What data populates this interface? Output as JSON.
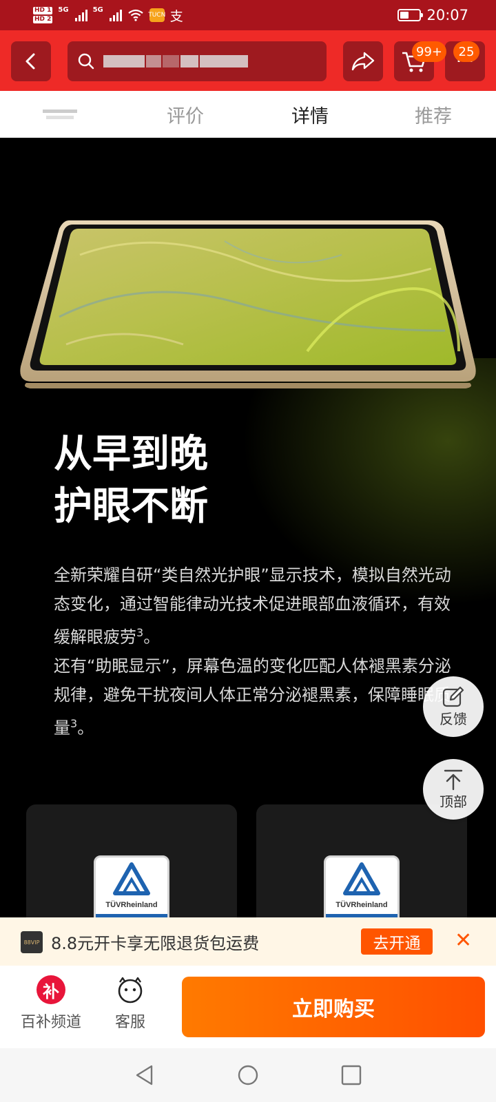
{
  "status_bar": {
    "time": "20:07",
    "hd_labels": [
      "HD 1",
      "HD 2"
    ],
    "network_labels": [
      "5G",
      "5G"
    ],
    "app_badge_text": "TUCN",
    "pay_icon": "支"
  },
  "header": {
    "cart_badge": "99+",
    "more_badge": "25"
  },
  "tabs": {
    "reviews": "评价",
    "details": "详情",
    "recommend": "推荐",
    "active": "details"
  },
  "content": {
    "headline_line1": "从早到晚",
    "headline_line2": "护眼不断",
    "paragraph1": "全新荣耀自研“类自然光护眼”显示技术，模拟自然光动态变化，通过智能律动光技术促进眼部血液循环，有效缓解眼疲劳",
    "paragraph1_sup": "3",
    "paragraph1_end": "。",
    "paragraph2": "还有“助眠显示”，屏幕色温的变化匹配人体褪黑素分泌规律，避免干扰夜间人体正常分泌褪黑素，保障睡眠质量",
    "paragraph2_sup": "3",
    "paragraph2_end": "。",
    "cert_label": "TÜVRheinland"
  },
  "floating": {
    "feedback": "反馈",
    "top": "顶部"
  },
  "vip_banner": {
    "logo": "88VIP",
    "text": "8.8元开卡享无限退货包运费",
    "button": "去开通",
    "close": "✕"
  },
  "bottom_bar": {
    "subsidy_icon": "补",
    "subsidy_label": "百补频道",
    "service_label": "客服",
    "buy_button": "立即购买"
  },
  "colors": {
    "status_bar": "#a9141c",
    "header": "#ee2a27",
    "header_button": "#9e1a1f",
    "accent": "#ff5500"
  }
}
